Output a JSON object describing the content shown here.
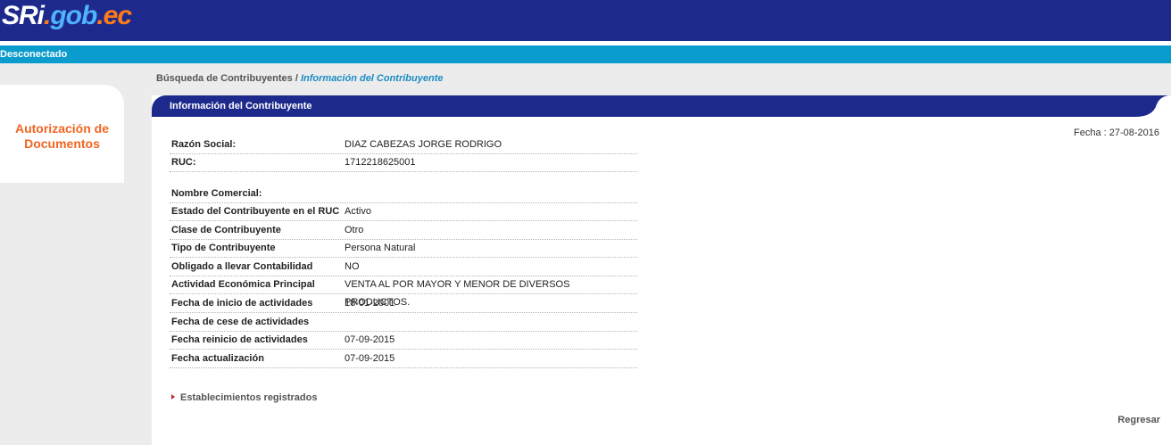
{
  "header": {
    "logo": {
      "part1": "SRi",
      "dot": ".",
      "part2": "gob",
      "part3": ".ec"
    },
    "status": "Desconectado"
  },
  "sidebar": {
    "title": "Autorización de Documentos"
  },
  "breadcrumb": {
    "parent": "Búsqueda de Contribuyentes",
    "separator": " / ",
    "current": "Información del Contribuyente"
  },
  "panel": {
    "title": "Información del Contribuyente",
    "fecha": "Fecha : 27-08-2016",
    "rows": [
      {
        "label": "Razón Social:",
        "value": "DIAZ CABEZAS JORGE RODRIGO"
      },
      {
        "label": "RUC:",
        "value": "1712218625001"
      },
      {
        "label": "Nombre Comercial:",
        "value": ""
      },
      {
        "label": "Estado del Contribuyente en el RUC",
        "value": "Activo"
      },
      {
        "label": "Clase de Contribuyente",
        "value": "Otro"
      },
      {
        "label": "Tipo de Contribuyente",
        "value": "Persona Natural"
      },
      {
        "label": "Obligado a llevar Contabilidad",
        "value": "NO"
      },
      {
        "label": "Actividad Económica Principal",
        "value": "VENTA AL POR MAYOR Y MENOR DE DIVERSOS PRODUCTOS."
      },
      {
        "label": "Fecha de inicio de actividades",
        "value": "18-01-2001"
      },
      {
        "label": "Fecha de cese de actividades",
        "value": ""
      },
      {
        "label": "Fecha reinicio de actividades",
        "value": "07-09-2015"
      },
      {
        "label": "Fecha actualización",
        "value": "07-09-2015"
      }
    ],
    "establecimientos_link": "Establecimientos registrados",
    "regresar_link": "Regresar"
  },
  "colors": {
    "header_bg": "#1d2a8c",
    "status_bg": "#0a9ccc",
    "accent_orange": "#f26522",
    "link_blue": "#1a8cc4"
  }
}
